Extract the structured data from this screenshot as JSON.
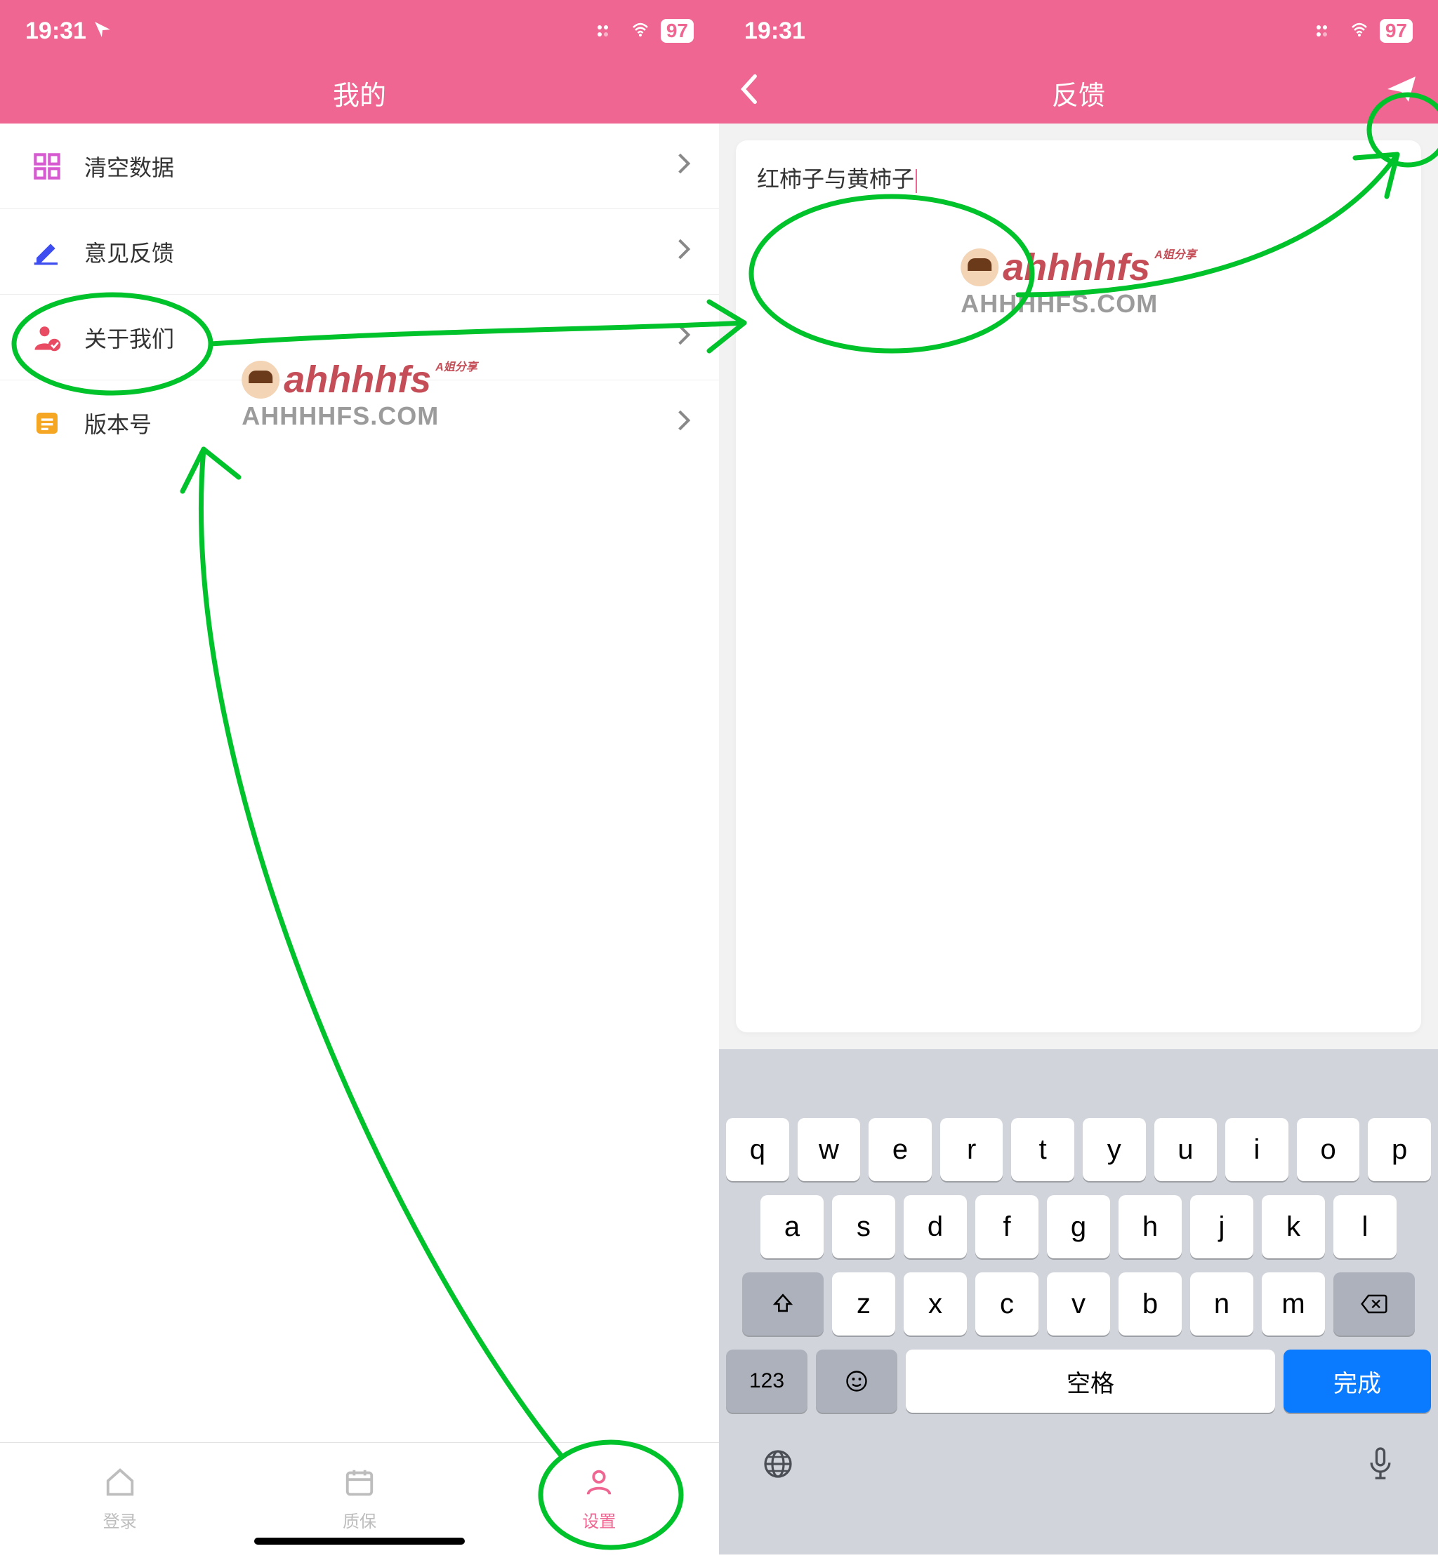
{
  "left": {
    "status_time": "19:31",
    "battery": "97",
    "title": "我的",
    "rows": {
      "clear": "清空数据",
      "feedback": "意见反馈",
      "about": "关于我们",
      "version": "版本号"
    },
    "tabs": {
      "login": "登录",
      "warranty": "质保",
      "settings": "设置"
    }
  },
  "right": {
    "status_time": "19:31",
    "battery": "97",
    "title": "反馈",
    "input_text": "红柿子与黄柿子",
    "keyboard": {
      "row1": [
        "q",
        "w",
        "e",
        "r",
        "t",
        "y",
        "u",
        "i",
        "o",
        "p"
      ],
      "row2": [
        "a",
        "s",
        "d",
        "f",
        "g",
        "h",
        "j",
        "k",
        "l"
      ],
      "row3": [
        "z",
        "x",
        "c",
        "v",
        "b",
        "n",
        "m"
      ],
      "num_label": "123",
      "space_label": "空格",
      "done_label": "完成"
    }
  },
  "watermark": {
    "brand": "ahhhhfs",
    "badge": "A姐分享",
    "site": "AHHHHFS.COM"
  }
}
